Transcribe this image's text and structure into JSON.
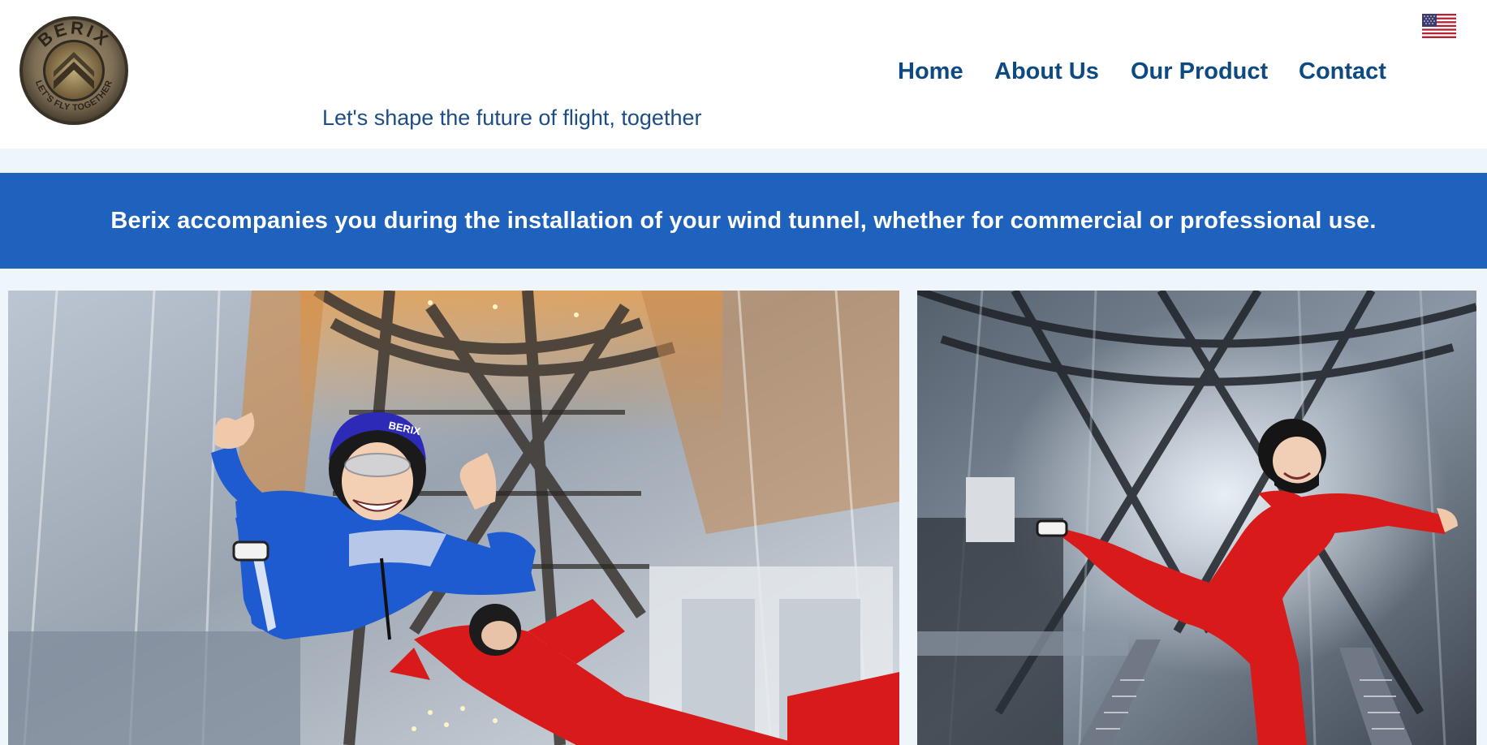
{
  "header": {
    "logo": {
      "brand_text": "BERIX",
      "slogan_text": "LET'S FLY TOGETHER"
    },
    "tagline": "Let's shape the future of flight, together",
    "nav": [
      {
        "label": "Home"
      },
      {
        "label": "About Us"
      },
      {
        "label": "Our Product"
      },
      {
        "label": "Contact"
      }
    ],
    "language_flag": "us-flag-icon"
  },
  "banner": {
    "text": "Berix accompanies you during the installation of your wind tunnel, whether for commercial or professional use."
  },
  "gallery": {
    "photo1": {
      "helmet_text": "BERIX"
    },
    "photo2": {}
  },
  "colors": {
    "nav_text": "#0e4a82",
    "banner_bg": "#1e62bd",
    "page_bg": "#eef5fb",
    "suit_blue": "#1f5bd0",
    "suit_red": "#d91a1a"
  }
}
